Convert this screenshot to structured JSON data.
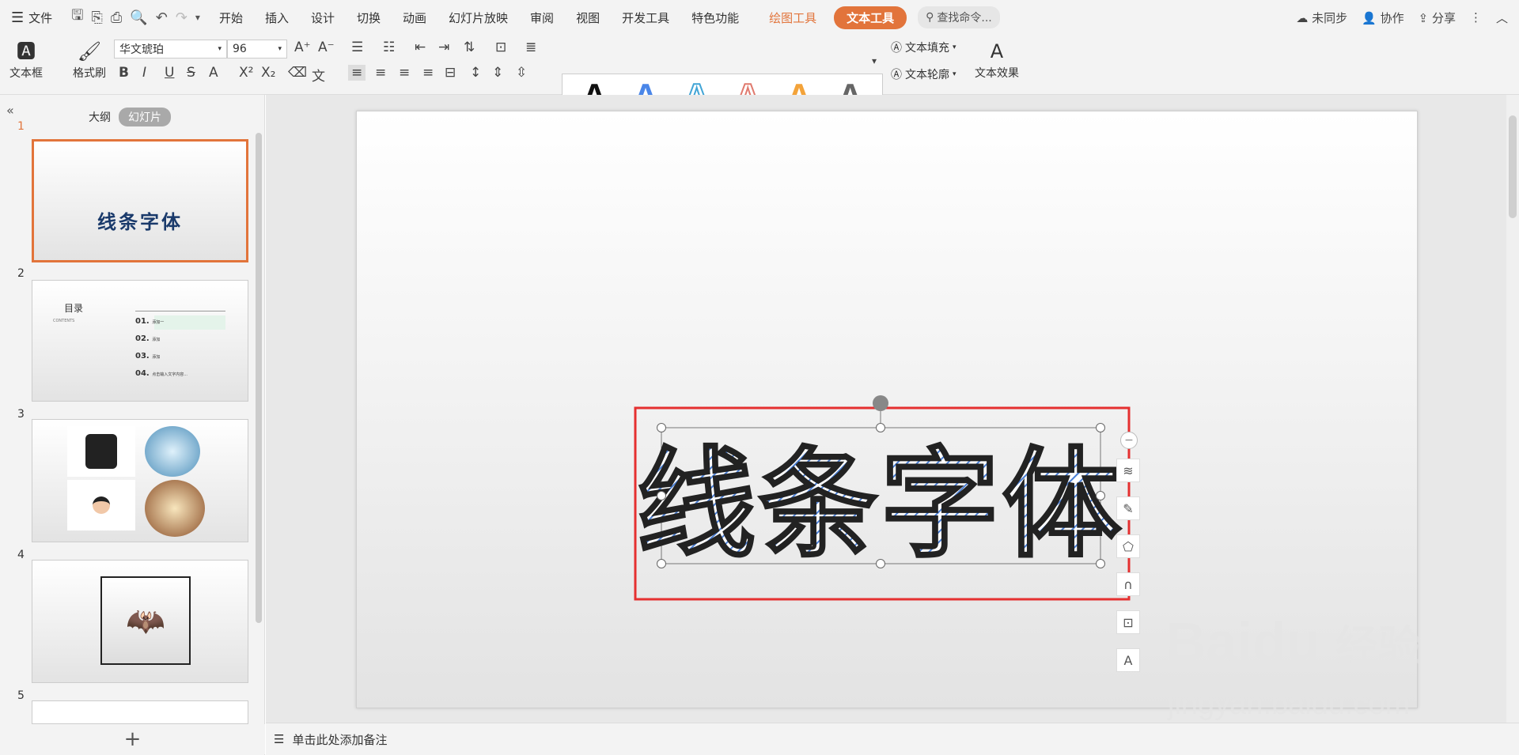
{
  "menubar": {
    "file": "文件",
    "items": [
      "开始",
      "插入",
      "设计",
      "切换",
      "动画",
      "幻灯片放映",
      "审阅",
      "视图",
      "开发工具",
      "特色功能"
    ],
    "drawing_tools": "绘图工具",
    "text_tools": "文本工具",
    "search": "查找命令...",
    "sync": "未同步",
    "collab": "协作",
    "share": "分享"
  },
  "ribbon": {
    "textbox": "文本框",
    "format_painter": "格式刷",
    "font": "华文琥珀",
    "size": "96",
    "fill": "文本填充",
    "outline": "文本轮廓",
    "effects": "文本效果",
    "style_letter": "A"
  },
  "panel": {
    "outline_tab": "大纲",
    "slides_tab": "幻灯片",
    "slide_numbers": [
      "1",
      "2",
      "3",
      "4",
      "5"
    ]
  },
  "thumbs": {
    "s1_title": "线条字体",
    "s2_title": "目录",
    "s2_sub": "CONTENTS",
    "s2_items": [
      {
        "n": "01.",
        "t": "添加一"
      },
      {
        "n": "02.",
        "t": "添加"
      },
      {
        "n": "03.",
        "t": "添加"
      },
      {
        "n": "04.",
        "t": "点击输入文字内容..."
      }
    ]
  },
  "slide": {
    "wordart": "线条字体"
  },
  "notes": "单击此处添加备注",
  "watermark": {
    "brand": "Baidu",
    "jy": "经验",
    "url": "jingyan.baidu.com"
  },
  "colors": {
    "accent": "#e2743b",
    "wordart_stroke": "#222222",
    "wordart_hatch": "#4a7fd6",
    "selection_box": "#e53030"
  }
}
